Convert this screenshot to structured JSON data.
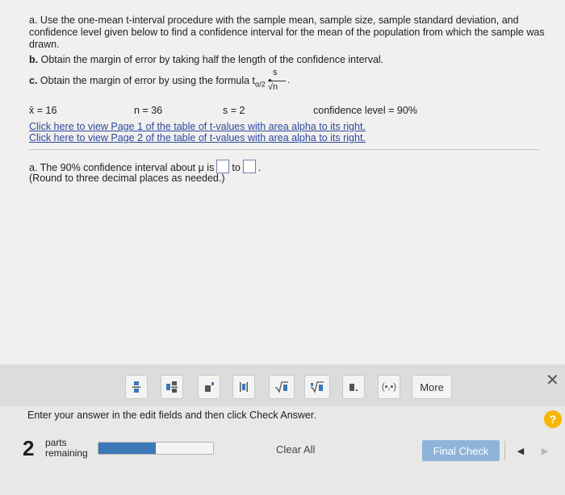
{
  "question": {
    "a": "a. Use the one-mean t-interval procedure with the sample mean, sample size, sample standard deviation, and confidence level given below to find a confidence interval for the mean of the population from which the sample was drawn.",
    "b_label": "b.",
    "b": "Obtain the margin of error by taking half the length of the confidence interval.",
    "c_label": "c.",
    "c": "Obtain the margin of error by using the formula t",
    "c_sub": "α/2",
    "c_dot": "•",
    "c_num": "s",
    "c_den": "√n",
    "c_end": "."
  },
  "values": {
    "mean": "x̄ = 16",
    "n": "n = 36",
    "s": "s = 2",
    "conf": "confidence level = 90%"
  },
  "links": {
    "page1": "Click here to view Page 1 of the table of t-values with area alpha to its right.",
    "page2": "Click here to view Page 2 of the table of t-values with area alpha to its right."
  },
  "answer": {
    "prompt": "a. The 90% confidence interval about μ is",
    "to": "to",
    "end": ".",
    "note": "(Round to three decimal places as needed.)",
    "lower_value": "",
    "upper_value": ""
  },
  "toolbar": {
    "buttons": [
      "fraction-icon",
      "mixed-number-icon",
      "exponent-icon",
      "absolute-value-icon",
      "square-root-icon",
      "nth-root-icon",
      "decimal-icon",
      "interval-icon"
    ],
    "interval_label": "(▪,▪)",
    "more": "More",
    "close": "✕"
  },
  "instruction": "Enter your answer in the edit fields and then click Check Answer.",
  "help": "?",
  "footer": {
    "count": "2",
    "parts": "parts",
    "remaining": "remaining",
    "progress": 0.5,
    "clear_all": "Clear All",
    "final_check": "Final Check",
    "prev": "◀",
    "next": "▶"
  },
  "colors": {
    "link": "#2d4aa0",
    "progress": "#3b78b6",
    "final_check": "#8fb4da",
    "help": "#f6b700"
  }
}
